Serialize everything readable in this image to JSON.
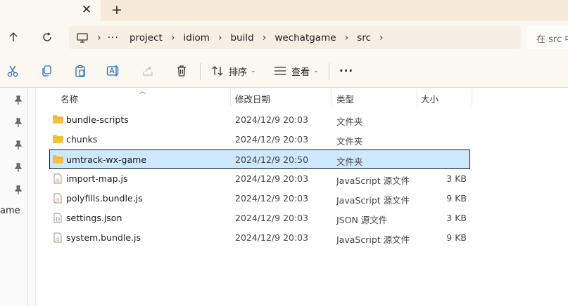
{
  "tabs": {
    "close_glyph": "✕",
    "new_glyph": "+"
  },
  "nav": {
    "up_icon": "arrow-up-icon",
    "refresh_icon": "refresh-icon",
    "breadcrumb": [
      "project",
      "idiom",
      "build",
      "wechatgame",
      "src"
    ],
    "search_placeholder": "在 src 中"
  },
  "toolbar": {
    "icons": [
      "cut-icon",
      "copy-icon",
      "paste-icon",
      "rename-icon",
      "share-icon",
      "delete-icon"
    ],
    "sort_label": "排序",
    "view_label": "查看",
    "more_glyph": "···"
  },
  "sidebar": {
    "partial_label": "ame"
  },
  "columns": {
    "name": "名称",
    "date": "修改日期",
    "type": "类型",
    "size": "大小"
  },
  "rows": [
    {
      "name": "bundle-scripts",
      "date": "2024/12/9 20:03",
      "type": "文件夹",
      "size": "",
      "kind": "folder"
    },
    {
      "name": "chunks",
      "date": "2024/12/9 20:03",
      "type": "文件夹",
      "size": "",
      "kind": "folder"
    },
    {
      "name": "umtrack-wx-game",
      "date": "2024/12/9 20:50",
      "type": "文件夹",
      "size": "",
      "kind": "folder",
      "selected": true
    },
    {
      "name": "import-map.js",
      "date": "2024/12/9 20:03",
      "type": "JavaScript 源文件",
      "size": "3 KB",
      "kind": "js"
    },
    {
      "name": "polyfills.bundle.js",
      "date": "2024/12/9 20:03",
      "type": "JavaScript 源文件",
      "size": "9 KB",
      "kind": "js"
    },
    {
      "name": "settings.json",
      "date": "2024/12/9 20:03",
      "type": "JSON 源文件",
      "size": "3 KB",
      "kind": "json"
    },
    {
      "name": "system.bundle.js",
      "date": "2024/12/9 20:03",
      "type": "JavaScript 源文件",
      "size": "9 KB",
      "kind": "js"
    }
  ],
  "colors": {
    "tab_bar": "#f6ead9",
    "selection_fill": "#cde8ff",
    "folder_yellow": "#f5c33b",
    "js_yellow": "#e0b000"
  }
}
